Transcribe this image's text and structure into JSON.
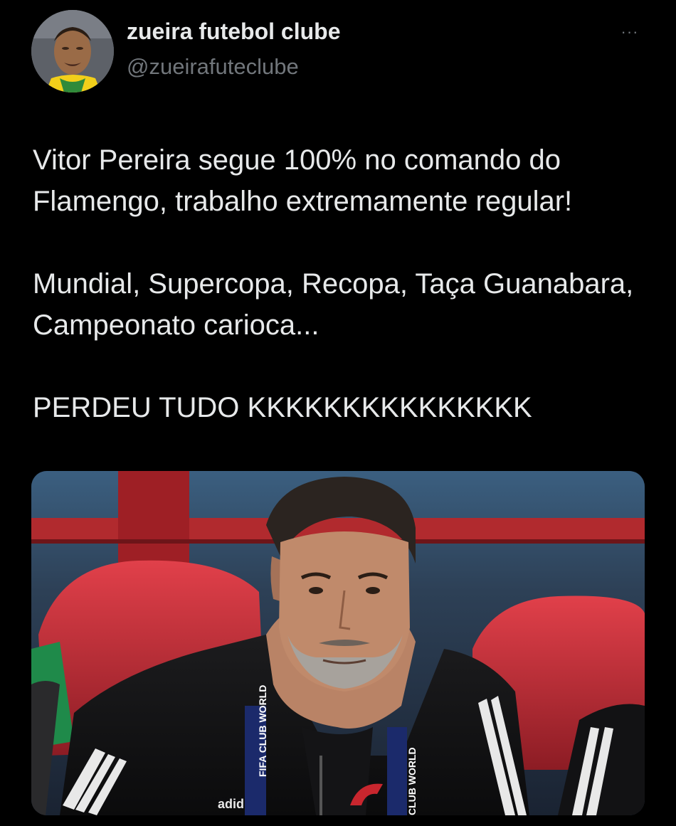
{
  "user": {
    "name": "zueira futebol clube",
    "handle": "@zueirafuteclube",
    "avatar_icon": "profile-photo"
  },
  "menu": {
    "icon": "more-horizontal-icon",
    "glyph": "···"
  },
  "tweet": {
    "paragraphs": [
      "Vitor Pereira segue 100% no comando do Flamengo, trabalho extremamente regular!",
      "Mundial, Supercopa, Recopa, Taça Guanabara, Campeonato carioca...",
      "PERDEU TUDO KKKKKKKKKKKKKKK"
    ]
  },
  "media": {
    "lanyard_text": "FIFA CLUB WORLD CUP",
    "brand_text": "adidas"
  },
  "colors": {
    "background": "#000000",
    "text_primary": "#e7e9ea",
    "text_secondary": "#71767b"
  }
}
